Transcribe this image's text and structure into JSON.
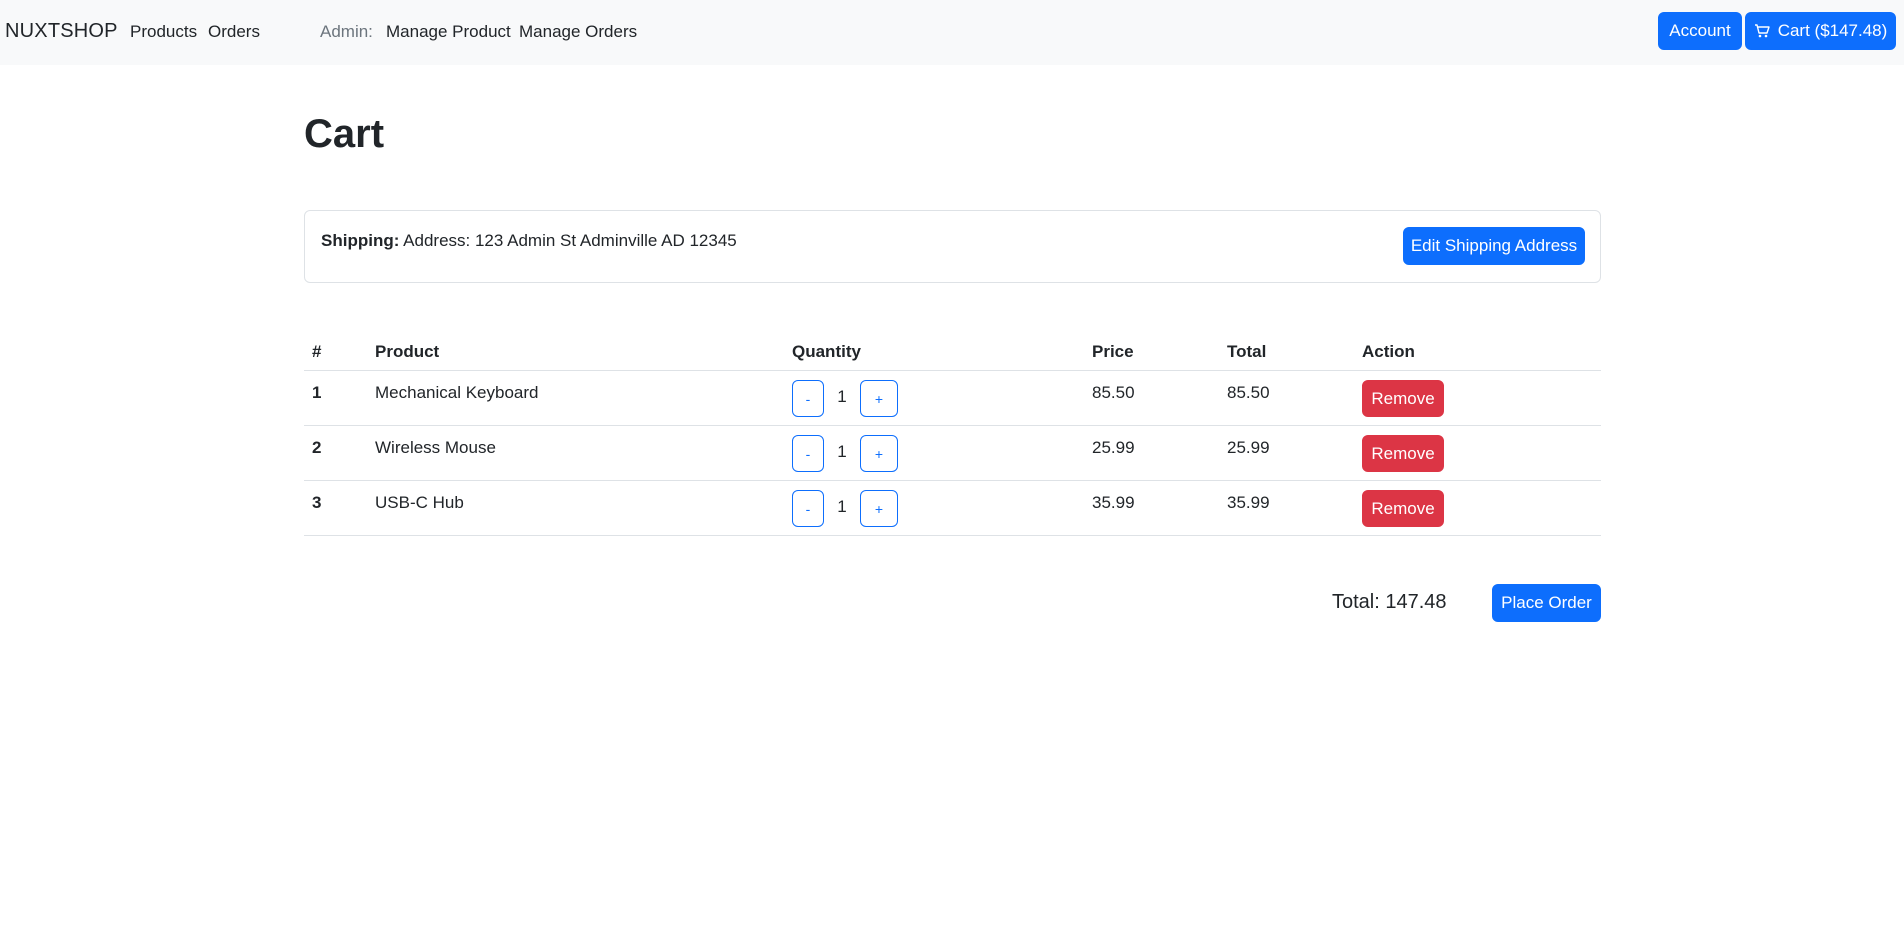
{
  "navbar": {
    "brand": "NUXTSHOP",
    "links": [
      "Products",
      "Orders"
    ],
    "admin_label": "Admin:",
    "admin_links": [
      "Manage Product",
      "Manage Orders"
    ],
    "account_label": "Account",
    "cart_label": "Cart ($147.48)"
  },
  "page": {
    "title": "Cart"
  },
  "shipping": {
    "label": "Shipping:",
    "address": "Address: 123 Admin St Adminville AD 12345",
    "edit_button": "Edit Shipping Address"
  },
  "table": {
    "headers": [
      "#",
      "Product",
      "Quantity",
      "Price",
      "Total",
      "Action"
    ],
    "rows": [
      {
        "index": "1",
        "product": "Mechanical Keyboard",
        "quantity": "1",
        "price": "85.50",
        "total": "85.50",
        "action": "Remove"
      },
      {
        "index": "2",
        "product": "Wireless Mouse",
        "quantity": "1",
        "price": "25.99",
        "total": "25.99",
        "action": "Remove"
      },
      {
        "index": "3",
        "product": "USB-C Hub",
        "quantity": "1",
        "price": "35.99",
        "total": "35.99",
        "action": "Remove"
      }
    ],
    "decrement_label": "-",
    "increment_label": "+"
  },
  "summary": {
    "total_label": "Total: 147.48",
    "place_order": "Place Order"
  },
  "colors": {
    "primary": "#0d6efd",
    "danger": "#dc3545",
    "navbar_bg": "#f8f9fa"
  }
}
